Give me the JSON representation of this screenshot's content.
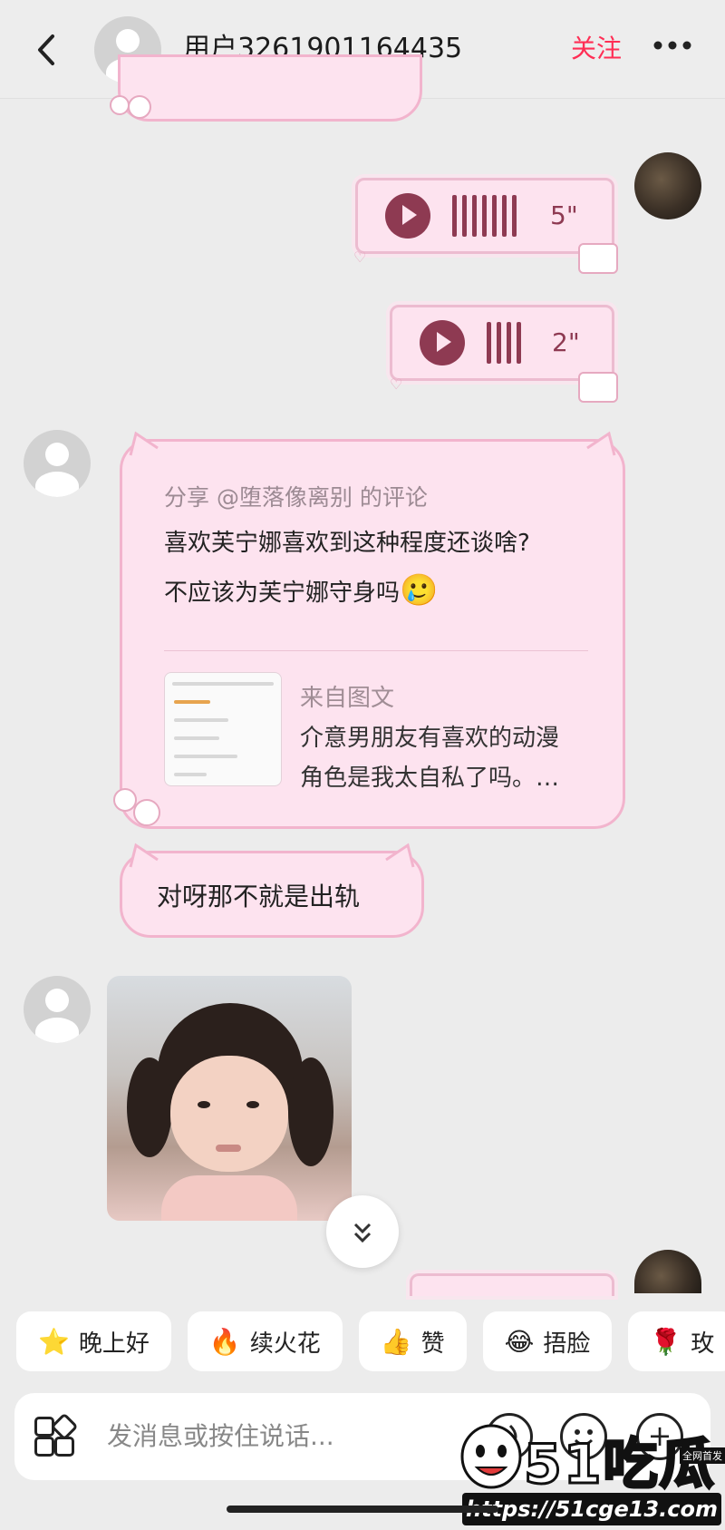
{
  "header": {
    "back_icon": "chevron-left-icon",
    "username": "用户3261901164435",
    "follow_label": "关注",
    "more_icon": "ellipsis-icon"
  },
  "messages": {
    "voice1_duration": "5\"",
    "voice2_duration": "2\"",
    "share": {
      "meta": "分享 @堕落像离别 的评论",
      "line1": "喜欢芙宁娜喜欢到这种程度还谈啥?",
      "line2": "不应该为芙宁娜守身吗",
      "line2_emoji": "🥲",
      "from_label": "来自图文",
      "from_text_1": "介意男朋友有喜欢的动漫",
      "from_text_2": "角色是我太自私了吗。…"
    },
    "reply_text": "对呀那不就是出轨"
  },
  "quick_replies": [
    {
      "emoji": "⭐",
      "label": "晚上好"
    },
    {
      "emoji": "🔥",
      "label": "续火花"
    },
    {
      "emoji": "👍",
      "label": "赞"
    },
    {
      "emoji": "😂",
      "label": "捂脸"
    },
    {
      "emoji": "🌹",
      "label": "玫"
    }
  ],
  "input": {
    "placeholder": "发消息或按住说话..."
  },
  "watermark": {
    "brand": "51吃瓜",
    "tag": "全网首发",
    "url": "https://51cge13.com"
  },
  "colors": {
    "accent": "#ff2e55",
    "bubble_pink": "#fde3ef",
    "bubble_border": "#f2b4cd",
    "voice_dark": "#8e3a52"
  }
}
